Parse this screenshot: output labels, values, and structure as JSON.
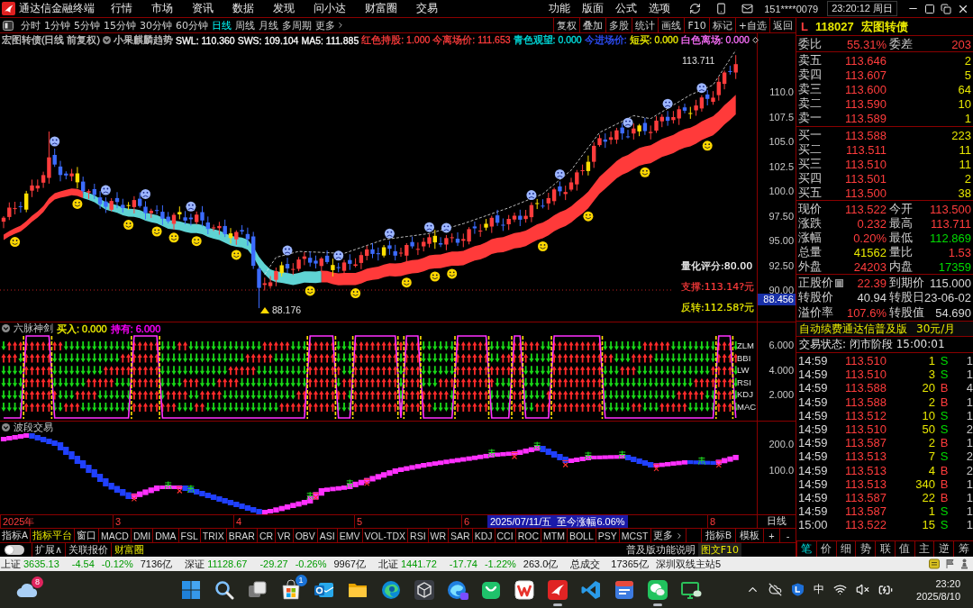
{
  "title_bar": {
    "app_name": "通达信金融终端",
    "menus": [
      "行情",
      "市场",
      "资讯",
      "数据",
      "发现",
      "问小达",
      "财富圈",
      "交易"
    ],
    "tools": [
      "功能",
      "版面",
      "公式",
      "选项"
    ],
    "account": "151****0079",
    "clock": "23:20:12 周日"
  },
  "period_bar": {
    "periods": [
      {
        "label": "分时",
        "selected": false
      },
      {
        "label": "1分钟",
        "selected": false
      },
      {
        "label": "5分钟",
        "selected": false
      },
      {
        "label": "15分钟",
        "selected": false
      },
      {
        "label": "30分钟",
        "selected": false
      },
      {
        "label": "60分钟",
        "selected": false
      },
      {
        "label": "日线",
        "selected": true
      },
      {
        "label": "周线",
        "selected": false
      },
      {
        "label": "月线",
        "selected": false
      },
      {
        "label": "多周期",
        "selected": false
      }
    ],
    "more": "更多",
    "actions": [
      "复权",
      "叠加",
      "多股",
      "统计",
      "画线",
      "F10",
      "标记",
      "+自选",
      "返回"
    ]
  },
  "main_chart": {
    "legend": [
      {
        "text": "宏图转债(日线 前复权)",
        "color": "#c8c8c8",
        "menu": false
      },
      {
        "text": "小果麒麟趋势",
        "color": "#c8c8c8",
        "menu": true
      },
      {
        "text": "SWL: 110.360",
        "color": "#ffffff",
        "menu": false
      },
      {
        "text": "SWS: 109.104",
        "color": "#ffffff",
        "menu": false
      },
      {
        "text": "MA5: 111.885",
        "color": "#ffffff",
        "menu": false
      },
      {
        "text": "红色持股: 1.000",
        "color": "#ff3c3c",
        "menu": false
      },
      {
        "text": "今离场价: 111.653",
        "color": "#ff3c3c",
        "menu": false
      },
      {
        "text": "青色观望: 0.000",
        "color": "#00e0e0",
        "menu": false
      },
      {
        "text": "今进场价:",
        "color": "#3050ff",
        "menu": false
      },
      {
        "text": "短买: 0.000",
        "color": "#e8e800",
        "menu": false
      },
      {
        "text": "白色离场: 0.000",
        "color": "#ff70ff",
        "menu": false
      }
    ],
    "high_label": "113.711",
    "low_label": "88.176",
    "notes": [
      {
        "text": "量化评分:80.00",
        "color": "#ffffff"
      },
      {
        "text": "支撑:113.14?元",
        "color": "#ff3c3c"
      },
      {
        "text": "反转:112.58?元",
        "color": "#e8e800"
      }
    ],
    "axis_labels": [
      "110.0",
      "107.5",
      "105.0",
      "102.5",
      "100.0",
      "97.50",
      "95.00",
      "92.50",
      "90.00"
    ],
    "cursor_price": "88.456"
  },
  "indicator_panel": {
    "title": "六脉神剑",
    "values": [
      {
        "text": "买入: 0.000",
        "color": "#e8e800"
      },
      {
        "text": "持有: 6.000",
        "color": "#ff00ff"
      }
    ],
    "rows": [
      "ZLM",
      "BBI",
      "LW",
      "RSI",
      "KDJ",
      "MAC"
    ],
    "axis_labels": [
      "6.000",
      "4.000",
      "2.000"
    ]
  },
  "wave_panel": {
    "title": "波段交易",
    "axis_labels": [
      "200.0",
      "100.0"
    ]
  },
  "date_axis": {
    "labels": [
      "2025年",
      "3",
      "4",
      "5",
      "6",
      "8"
    ],
    "cursor": "2025/07/11/五  至今涨幅6.06%",
    "period": "日线"
  },
  "indicator_tabs": {
    "left": [
      {
        "label": "指标A",
        "selected": false
      },
      {
        "label": "指标平台",
        "selected": true
      },
      {
        "label": "窗口",
        "selected": false
      }
    ],
    "indicators": [
      {
        "label": "MACD",
        "selected": false
      },
      {
        "label": "DMI",
        "selected": false
      },
      {
        "label": "DMA",
        "selected": false
      },
      {
        "label": "FSL",
        "selected": false
      },
      {
        "label": "TRIX",
        "selected": false
      },
      {
        "label": "BRAR",
        "selected": false
      },
      {
        "label": "CR",
        "selected": false
      },
      {
        "label": "VR",
        "selected": false
      },
      {
        "label": "OBV",
        "selected": false
      },
      {
        "label": "ASI",
        "selected": false
      },
      {
        "label": "EMV",
        "selected": false
      },
      {
        "label": "VOL-TDX",
        "selected": false
      },
      {
        "label": "RSI",
        "selected": false
      },
      {
        "label": "WR",
        "selected": false
      },
      {
        "label": "SAR",
        "selected": false
      },
      {
        "label": "KDJ",
        "selected": false
      },
      {
        "label": "CCI",
        "selected": false
      },
      {
        "label": "ROC",
        "selected": false
      },
      {
        "label": "MTM",
        "selected": false
      },
      {
        "label": "BOLL",
        "selected": false
      },
      {
        "label": "PSY",
        "selected": false
      },
      {
        "label": "MCST",
        "selected": false
      }
    ],
    "more": "更多",
    "right": [
      "指标B",
      "模板",
      "+",
      "-"
    ]
  },
  "bottom_bar": {
    "toggle_on": false,
    "links": [
      {
        "label": "扩展∧",
        "highlighted": false
      },
      {
        "label": "关联报价",
        "highlighted": false
      },
      {
        "label": "财富圈",
        "highlighted": true
      }
    ],
    "help": "普及版功能说明",
    "f10": "图文F10"
  },
  "quote_panel": {
    "market": "L",
    "code": "118027",
    "name": "宏图转债",
    "ratio": [
      {
        "label": "委比",
        "value": "55.31%",
        "color": "#ff3c3c"
      },
      {
        "label": "委差",
        "value": "203",
        "color": "#ff3c3c"
      }
    ],
    "asks": [
      {
        "label": "卖五",
        "price": "113.646",
        "volume": "2"
      },
      {
        "label": "卖四",
        "price": "113.607",
        "volume": "5"
      },
      {
        "label": "卖三",
        "price": "113.600",
        "volume": "64"
      },
      {
        "label": "卖二",
        "price": "113.590",
        "volume": "10"
      },
      {
        "label": "卖一",
        "price": "113.589",
        "volume": "1"
      }
    ],
    "bids": [
      {
        "label": "买一",
        "price": "113.588",
        "volume": "223"
      },
      {
        "label": "买二",
        "price": "113.511",
        "volume": "11"
      },
      {
        "label": "买三",
        "price": "113.510",
        "volume": "11"
      },
      {
        "label": "买四",
        "price": "113.501",
        "volume": "2"
      },
      {
        "label": "买五",
        "price": "113.500",
        "volume": "38"
      }
    ],
    "stats": [
      {
        "label": "现价",
        "value": "113.522",
        "color": "#ff3c3c"
      },
      {
        "label": "今开",
        "value": "113.500",
        "color": "#ff3c3c"
      },
      {
        "label": "涨跌",
        "value": "0.232",
        "color": "#ff3c3c"
      },
      {
        "label": "最高",
        "value": "113.711",
        "color": "#ff3c3c"
      },
      {
        "label": "涨幅",
        "value": "0.20%",
        "color": "#ff3c3c"
      },
      {
        "label": "最低",
        "value": "112.869",
        "color": "#00dc00"
      },
      {
        "label": "总量",
        "value": "41562",
        "color": "#e8e800"
      },
      {
        "label": "量比",
        "value": "1.53",
        "color": "#ff3c3c"
      },
      {
        "label": "外盘",
        "value": "24203",
        "color": "#ff3c3c"
      },
      {
        "label": "内盘",
        "value": "17359",
        "color": "#00dc00"
      }
    ],
    "bond": [
      {
        "label": "正股价",
        "value": "22.39",
        "color": "#ff3c3c",
        "info": true
      },
      {
        "label": "到期价",
        "value": "115.000",
        "color": "#d8d8d8",
        "info": false
      },
      {
        "label": "转股价",
        "value": "40.94",
        "color": "#d8d8d8",
        "info": false
      },
      {
        "label": "转股日",
        "value": "23-06-02",
        "color": "#d8d8d8",
        "info": false
      },
      {
        "label": "溢价率",
        "value": "107.6%",
        "color": "#ff3c3c",
        "info": false
      },
      {
        "label": "转股值",
        "value": "54.690",
        "color": "#d8d8d8",
        "info": false
      }
    ],
    "promo": {
      "text": "自动续费通达信普及版",
      "price": "30元/月"
    },
    "trade_status": "交易状态: 闭市阶段 15:00:01",
    "trades": [
      {
        "time": "14:59",
        "price": "113.510",
        "volume": "1",
        "side": "S",
        "kind": "sell",
        "count": "1"
      },
      {
        "time": "14:59",
        "price": "113.510",
        "volume": "3",
        "side": "S",
        "kind": "sell",
        "count": "1"
      },
      {
        "time": "14:59",
        "price": "113.588",
        "volume": "20",
        "side": "B",
        "kind": "buy",
        "count": "4"
      },
      {
        "time": "14:59",
        "price": "113.588",
        "volume": "2",
        "side": "B",
        "kind": "buy",
        "count": "1"
      },
      {
        "time": "14:59",
        "price": "113.512",
        "volume": "10",
        "side": "S",
        "kind": "sell",
        "count": "1"
      },
      {
        "time": "14:59",
        "price": "113.510",
        "volume": "50",
        "side": "S",
        "kind": "sell",
        "count": "2"
      },
      {
        "time": "14:59",
        "price": "113.587",
        "volume": "2",
        "side": "B",
        "kind": "buy",
        "count": "1"
      },
      {
        "time": "14:59",
        "price": "113.513",
        "volume": "7",
        "side": "S",
        "kind": "sell",
        "count": "2"
      },
      {
        "time": "14:59",
        "price": "113.513",
        "volume": "4",
        "side": "B",
        "kind": "buy",
        "count": "2"
      },
      {
        "time": "14:59",
        "price": "113.513",
        "volume": "340",
        "side": "B",
        "kind": "buy",
        "count": "1"
      },
      {
        "time": "14:59",
        "price": "113.587",
        "volume": "22",
        "side": "B",
        "kind": "buy",
        "count": "1"
      },
      {
        "time": "14:59",
        "price": "113.587",
        "volume": "1",
        "side": "S",
        "kind": "sell",
        "count": "1"
      },
      {
        "time": "15:00",
        "price": "113.522",
        "volume": "15",
        "side": "S",
        "kind": "sell",
        "count": "1"
      }
    ],
    "detail_tabs": [
      {
        "label": "笔",
        "selected": true
      },
      {
        "label": "价",
        "selected": false
      },
      {
        "label": "细",
        "selected": false
      },
      {
        "label": "势",
        "selected": false
      },
      {
        "label": "联",
        "selected": false
      },
      {
        "label": "值",
        "selected": false
      },
      {
        "label": "主",
        "selected": false
      },
      {
        "label": "逆",
        "selected": false
      },
      {
        "label": "筹",
        "selected": false
      }
    ]
  },
  "status_bar": {
    "indices": [
      {
        "name": "上证",
        "value": "3635.13",
        "change": "-4.54",
        "percent": "-0.12%",
        "amount": "7136亿",
        "color": "#009a00"
      },
      {
        "name": "深证",
        "value": "11128.67",
        "change": "-29.27",
        "percent": "-0.26%",
        "amount": "9967亿",
        "color": "#009a00"
      },
      {
        "name": "北证",
        "value": "1441.72",
        "change": "-17.74",
        "percent": "-1.22%",
        "amount": "263.0亿",
        "color": "#009a00"
      }
    ],
    "turnover_label": "总成交",
    "turnover": "17365亿",
    "server": "深圳双线主站5"
  },
  "taskbar": {
    "weather": {
      "badge": "8"
    },
    "apps": [
      {
        "kind": "start",
        "active": false
      },
      {
        "kind": "search",
        "active": false
      },
      {
        "kind": "taskview",
        "active": false
      },
      {
        "kind": "store",
        "active": false,
        "badge": "1"
      },
      {
        "kind": "mail",
        "active": false
      },
      {
        "kind": "folder",
        "active": false
      },
      {
        "kind": "edge",
        "active": false
      },
      {
        "kind": "cube",
        "active": false
      },
      {
        "kind": "edge-ai",
        "active": false
      },
      {
        "kind": "bag",
        "active": false
      },
      {
        "kind": "wps",
        "active": false
      },
      {
        "kind": "tdx",
        "active": true
      },
      {
        "kind": "code",
        "active": false
      },
      {
        "kind": "tool",
        "active": false
      },
      {
        "kind": "wechat",
        "active": true
      },
      {
        "kind": "screen-chat",
        "active": false
      }
    ],
    "tray": {
      "ime": "中",
      "time": "23:20",
      "date": "2025/8/10"
    }
  }
}
